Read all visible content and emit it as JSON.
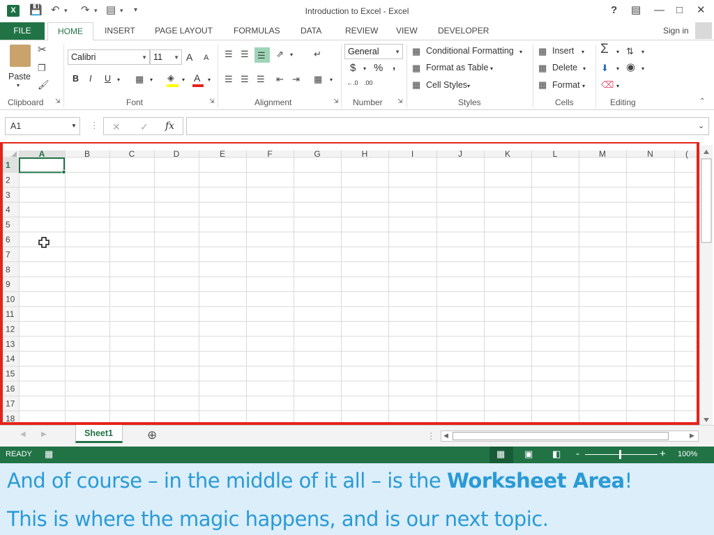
{
  "window": {
    "title": "Introduction to Excel - Excel",
    "help": "?",
    "logo": "X"
  },
  "tabs": {
    "file": "FILE",
    "items": [
      "HOME",
      "INSERT",
      "PAGE LAYOUT",
      "FORMULAS",
      "DATA",
      "REVIEW",
      "VIEW",
      "DEVELOPER"
    ],
    "sign_in": "Sign in"
  },
  "ribbon": {
    "clipboard": {
      "paste": "Paste",
      "label": "Clipboard"
    },
    "font": {
      "name": "Calibri",
      "size": "11",
      "bold": "B",
      "italic": "I",
      "underline": "U",
      "grow": "A",
      "shrink": "A",
      "color": "A",
      "label": "Font"
    },
    "alignment": {
      "label": "Alignment"
    },
    "number": {
      "format": "General",
      "currency": "$",
      "percent": "%",
      "comma": ",",
      "inc": "←.0",
      "dec": ".00",
      "label": "Number"
    },
    "styles": {
      "conditional": "Conditional Formatting",
      "table": "Format as Table",
      "cell": "Cell Styles",
      "label": "Styles"
    },
    "cells": {
      "insert": "Insert",
      "delete": "Delete",
      "format": "Format",
      "label": "Cells"
    },
    "editing": {
      "label": "Editing"
    }
  },
  "formula_bar": {
    "name_box": "A1",
    "fx": "fx",
    "cancel": "✕",
    "enter": "✓",
    "value": ""
  },
  "grid": {
    "columns": [
      "A",
      "B",
      "C",
      "D",
      "E",
      "F",
      "G",
      "H",
      "I",
      "J",
      "K",
      "L",
      "M",
      "N",
      "("
    ],
    "rows": [
      "1",
      "2",
      "3",
      "4",
      "5",
      "6",
      "7",
      "8",
      "9",
      "10",
      "11",
      "12",
      "13",
      "14",
      "15",
      "16",
      "17",
      "18"
    ],
    "active_cell": "A1",
    "highlight_color": "#e3241b"
  },
  "sheets": {
    "tabs": [
      "Sheet1"
    ],
    "add": "⊕"
  },
  "status": {
    "ready": "READY",
    "zoom": "100%",
    "minus": "-",
    "plus": "+"
  },
  "caption": {
    "line1_prefix": "And of course – in the middle of it all – is the ",
    "line1_bold": "Worksheet Area",
    "line1_suffix": "!",
    "line2": "This is where the magic happens, and is our next topic."
  },
  "colors": {
    "excel_green": "#217346",
    "caption_bg": "#dbeefa",
    "caption_text": "#2a9ad6"
  }
}
